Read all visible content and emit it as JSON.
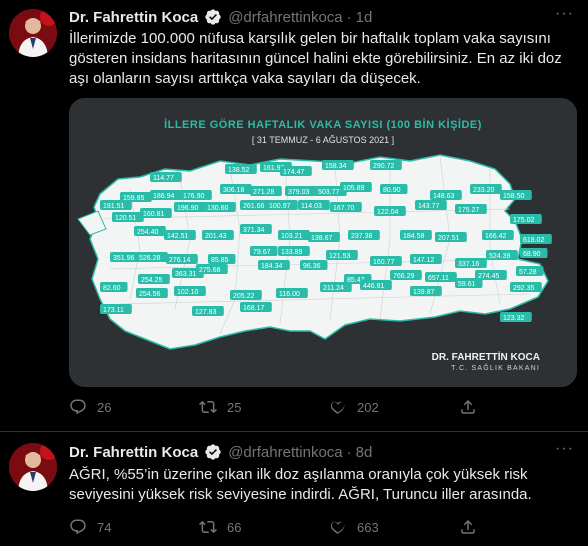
{
  "tweets": [
    {
      "name": "Dr. Fahrettin Koca",
      "handle": "@drfahrettinkoca",
      "separator": "·",
      "time": "1d",
      "text": "İllerimizde 100.000 nüfusa karşılık gelen bir haftalık toplam vaka sayısını gösteren insidans haritasının güncel halini ekte görebilirsiniz. En az iki doz aşı olanların sayısı arttıkça vaka sayıları da düşecek.",
      "image": {
        "title": "İLLERE GÖRE HAFTALIK VAKA SAYISI (100 BİN KİŞİDE)",
        "dates": "[ 31 TEMMUZ - 6 AĞUSTOS 2021 ]",
        "signature": "DR. FAHRETTİN KOCA",
        "ministry": "T.C. SAĞLIK BAKANI",
        "labels": [
          "114.77",
          "161.98",
          "138.52",
          "174.47",
          "158.34",
          "290.72",
          "191.51",
          "159.85",
          "186.94",
          "176.90",
          "306.18",
          "271.28",
          "379.03",
          "503.77",
          "105.89",
          "80.90",
          "148.63",
          "233.20",
          "158.50",
          "120.51",
          "160.81",
          "196.90",
          "130.60",
          "261.66",
          "100.97",
          "114.03",
          "167.70",
          "122.04",
          "143.77",
          "175.27",
          "175.02",
          "254.40",
          "142.51",
          "201.43",
          "371.34",
          "103.21",
          "138.67",
          "237.38",
          "184.58",
          "207.51",
          "166.42",
          "618.02",
          "351.96",
          "526.28",
          "276.14",
          "85.85",
          "79.67",
          "133.89",
          "121.53",
          "160.77",
          "147.12",
          "337.16",
          "524.39",
          "68.90",
          "82.60",
          "254.25",
          "363.31",
          "275.68",
          "184.34",
          "96.36",
          "85.47",
          "766.29",
          "657.11",
          "274.45",
          "57.28",
          "173.11",
          "254.56",
          "102.10",
          "205.22",
          "116.00",
          "211.24",
          "446.81",
          "139.87",
          "59.61",
          "292.35",
          "123.32",
          "127.83",
          "168.17"
        ]
      },
      "replies": "26",
      "retweets": "25",
      "likes": "202"
    },
    {
      "name": "Dr. Fahrettin Koca",
      "handle": "@drfahrettinkoca",
      "separator": "·",
      "time": "8d",
      "text": "AĞRI, %55’in üzerine çıkan ilk doz aşılanma oranıyla çok yüksek risk seviyesini yüksek risk seviyesine indirdi. AĞRI, Turuncu iller arasında.",
      "replies": "74",
      "retweets": "66",
      "likes": "663"
    }
  ],
  "colors": {
    "background": "#000000",
    "text": "#e7e9ea",
    "muted": "#71767b",
    "verified": "#1d9bf0",
    "map_teal": "#2bbca9",
    "map_bg": "#2e3133"
  }
}
